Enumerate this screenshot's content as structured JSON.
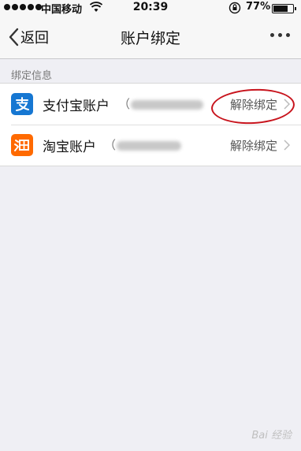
{
  "status_bar": {
    "carrier": "中国移动",
    "time": "20:39",
    "battery_percent": "77%",
    "battery_level": 0.77
  },
  "nav": {
    "back_label": "返回",
    "title": "账户绑定"
  },
  "section": {
    "header": "绑定信息"
  },
  "accounts": [
    {
      "title": "支付宝账户",
      "masked_prefix": "（",
      "action": "解除绑定",
      "icon": "alipay-icon",
      "color": "#1677d2"
    },
    {
      "title": "淘宝账户",
      "masked_prefix": "（",
      "action": "解除绑定",
      "icon": "taobao-icon",
      "color": "#ff6a00"
    }
  ],
  "watermark": "Bai 经验"
}
